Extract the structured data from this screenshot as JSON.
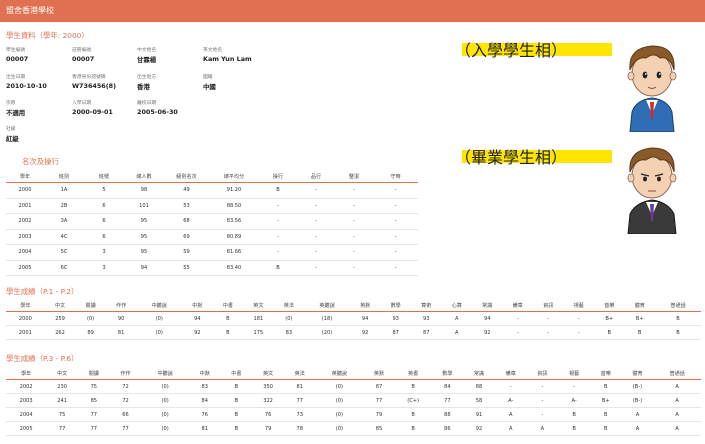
{
  "app": {
    "title": "盟舍香港學校"
  },
  "info": {
    "section_title": "學生資料（學年: 2000）",
    "fields": [
      {
        "label": "學生編號",
        "value": "00007"
      },
      {
        "label": "註冊編號",
        "value": "00007"
      },
      {
        "label": "中文姓名",
        "value": "甘霖楊"
      },
      {
        "label": "英文姓名",
        "value": "Kam Yun Lam"
      },
      {
        "label": "出生日期",
        "value": "2010-10-10"
      },
      {
        "label": "香港身份證號碼",
        "value": "W736456(8)"
      },
      {
        "label": "出生地方",
        "value": "香港"
      },
      {
        "label": "國籍",
        "value": "中國"
      },
      {
        "label": "宗教",
        "value": "不適用"
      },
      {
        "label": "入學日期",
        "value": "2000-09-01"
      },
      {
        "label": "離校日期",
        "value": "2005-06-30"
      },
      {
        "label": "社級",
        "value": "紅級"
      }
    ]
  },
  "rank": {
    "section_title": "名次及操行",
    "headers": [
      "學年",
      "班別",
      "班號",
      "總人數",
      "級別名次",
      "總平均分",
      "操行",
      "品行",
      "整潔",
      "守時"
    ],
    "rows": [
      [
        "2000",
        "1A",
        "5",
        "98",
        "49",
        "91.20",
        "B",
        "-",
        "-",
        "-"
      ],
      [
        "2001",
        "2B",
        "6",
        "101",
        "53",
        "88.50",
        "-",
        "-",
        "-",
        "-"
      ],
      [
        "2002",
        "3A",
        "6",
        "95",
        "68",
        "83.56",
        "-",
        "-",
        "-",
        "-"
      ],
      [
        "2003",
        "4C",
        "6",
        "95",
        "69",
        "80.89",
        "-",
        "-",
        "-",
        "-"
      ],
      [
        "2004",
        "5C",
        "3",
        "95",
        "59",
        "81.66",
        "-",
        "-",
        "-",
        "-"
      ],
      [
        "2005",
        "6C",
        "3",
        "94",
        "55",
        "83.40",
        "B",
        "-",
        "-",
        "-"
      ]
    ]
  },
  "grades1": {
    "section_title": "學生成績（P.1 - P.2）",
    "headers": [
      "學年",
      "中文",
      "閱讀",
      "作作",
      "中聽說",
      "中默",
      "中書",
      "英文",
      "英法",
      "英聽說",
      "英默",
      "數學",
      "算術",
      "心算",
      "常識",
      "備章",
      "資訊",
      "視藝",
      "音樂",
      "體育",
      "普通話"
    ],
    "rows": [
      [
        "2000",
        "259",
        "(0)",
        "90",
        "(0)",
        "94",
        "B",
        "181",
        "(0)",
        "(18)",
        "94",
        "93",
        "93",
        "A",
        "94",
        "-",
        "-",
        "-",
        "B+",
        "B+",
        "B"
      ],
      [
        "2001",
        "262",
        "89",
        "81",
        "(0)",
        "92",
        "B",
        "175",
        "83",
        "(20)",
        "92",
        "87",
        "87",
        "A",
        "92",
        "-",
        "-",
        "-",
        "B",
        "B",
        "B"
      ]
    ]
  },
  "grades2": {
    "section_title": "學生成績（P.3 - P.6）",
    "headers": [
      "學年",
      "中文",
      "閱讀",
      "作作",
      "中聽說",
      "中默",
      "中書",
      "英文",
      "英法",
      "英聽說",
      "英默",
      "英書",
      "數學",
      "常識",
      "備章",
      "資訊",
      "視藝",
      "音樂",
      "體育",
      "普通話"
    ],
    "rows": [
      [
        "2002",
        "230",
        "75",
        "72",
        "(0)",
        "83",
        "B",
        "350",
        "81",
        "(0)",
        "87",
        "B",
        "84",
        "88",
        "-",
        "-",
        "-",
        "B",
        "(B-)",
        "A"
      ],
      [
        "2003",
        "241",
        "85",
        "72",
        "(0)",
        "84",
        "B",
        "322",
        "77",
        "(0)",
        "77",
        "(C+)",
        "77",
        "58",
        "A-",
        "-",
        "A-",
        "B+",
        "(B-)",
        "A"
      ],
      [
        "2004",
        "75",
        "77",
        "66",
        "(0)",
        "76",
        "B",
        "76",
        "73",
        "(0)",
        "79",
        "B",
        "88",
        "91",
        "A",
        "-",
        "B",
        "B",
        "A",
        "A"
      ],
      [
        "2005",
        "77",
        "77",
        "77",
        "(0)",
        "81",
        "B",
        "79",
        "78",
        "(0)",
        "85",
        "B",
        "86",
        "92",
        "A",
        "A",
        "B",
        "B",
        "A",
        "A"
      ]
    ]
  },
  "photos": {
    "admission_label": "（入學學生相）",
    "graduation_label": "（畢業學生相）"
  },
  "colors": {
    "accent": "#e07050",
    "banner": "#ffe500"
  }
}
